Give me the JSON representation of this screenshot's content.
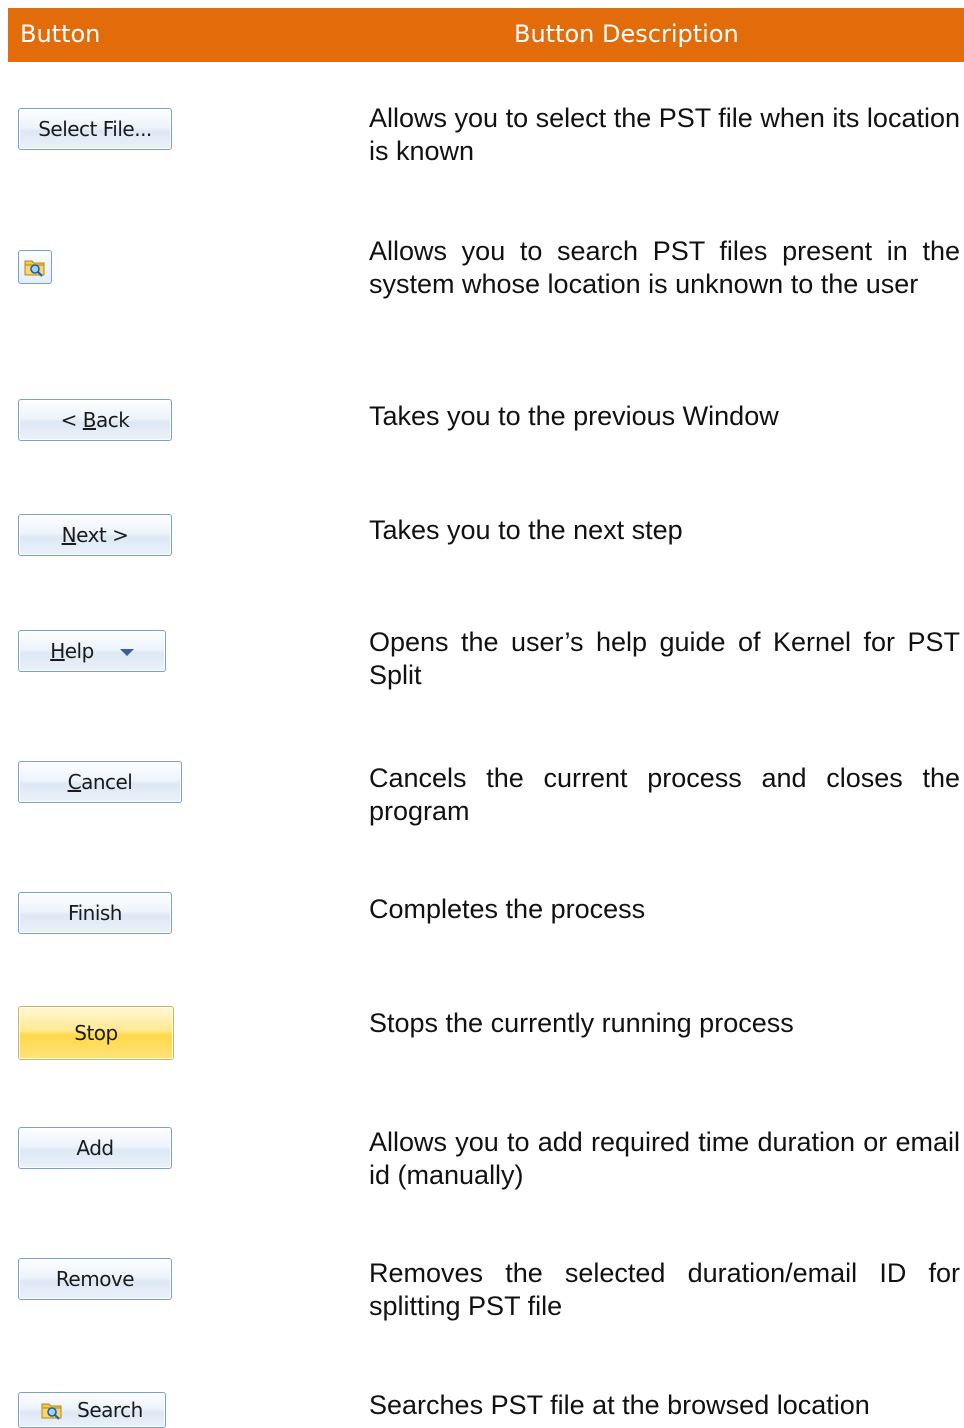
{
  "header": {
    "col_button": "Button",
    "col_description": "Button Description"
  },
  "rows": [
    {
      "label": "Select File...",
      "description": "Allows you to select the PST file when its location is known"
    },
    {
      "label": "",
      "icon": "folder-search-icon",
      "description": "Allows you to search PST files present in the system whose location is unknown to the user"
    },
    {
      "label_pre": "< ",
      "label_ul": "B",
      "label_post": "ack",
      "description": "Takes you to the previous Window"
    },
    {
      "label_ul": "N",
      "label_post": "ext >",
      "description": "Takes you to the next step"
    },
    {
      "label_ul": "H",
      "label_post": "elp",
      "icon": "dropdown-arrow-icon",
      "description": "Opens the user’s help guide of Kernel for PST Split"
    },
    {
      "label_ul": "C",
      "label_post": "ancel",
      "description": "Cancels the current process and closes the program"
    },
    {
      "label": "Finish",
      "description": "Completes the process"
    },
    {
      "label": "Stop",
      "description": "Stops the currently running process"
    },
    {
      "label": "Add",
      "description": "Allows you to add required time duration or email id (manually)"
    },
    {
      "label": "Remove",
      "description": "Removes the selected duration/email ID for splitting PST file"
    },
    {
      "label": "Search",
      "icon": "folder-search-icon",
      "description": "Searches PST file at the browsed location"
    }
  ],
  "colors": {
    "header_bg": "#e36c0a",
    "header_text": "#ffffff",
    "button_border": "#7aa0cf",
    "stop_button_fill": "#ffd84a"
  }
}
